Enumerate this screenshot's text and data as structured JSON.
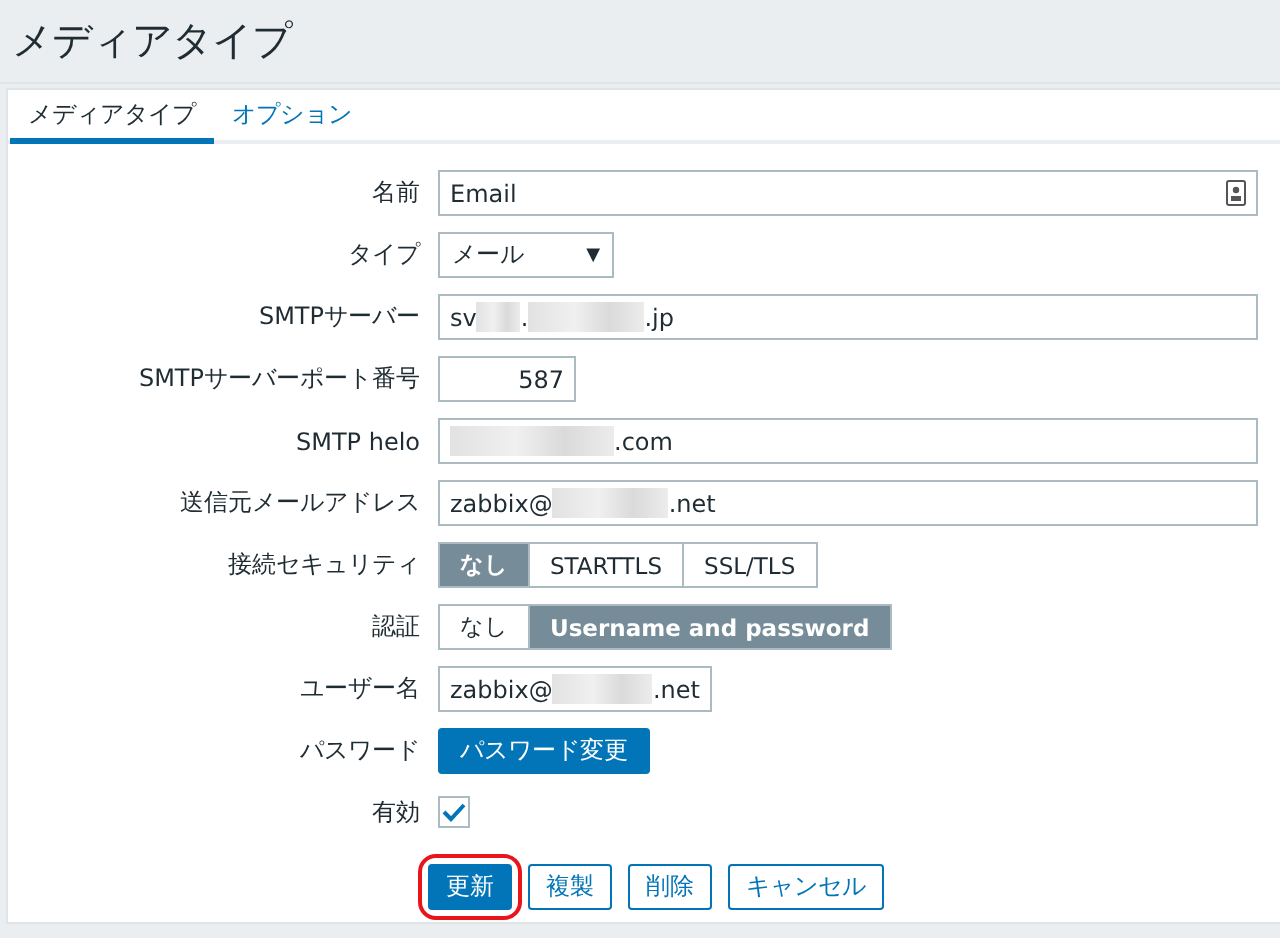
{
  "page": {
    "title": "メディアタイプ"
  },
  "tabs": [
    {
      "label": "メディアタイプ",
      "selected": true
    },
    {
      "label": "オプション",
      "selected": false
    }
  ],
  "form": [
    {
      "kind": "text",
      "label": "名前",
      "icon": true,
      "segments": [
        {
          "kind": "text",
          "text": "Email"
        }
      ]
    },
    {
      "kind": "select",
      "label": "タイプ",
      "value": "メール",
      "arrow": "▼"
    },
    {
      "kind": "text",
      "label": "SMTPサーバー",
      "segments": [
        {
          "kind": "text",
          "text": "sv"
        },
        {
          "kind": "mask-s"
        },
        {
          "kind": "text",
          "text": "."
        },
        {
          "kind": "mask-m"
        },
        {
          "kind": "text",
          "text": ".jp"
        }
      ]
    },
    {
      "kind": "number",
      "label": "SMTPサーバーポート番号",
      "value": "587"
    },
    {
      "kind": "text",
      "label": "SMTP helo",
      "segments": [
        {
          "kind": "mask-l"
        },
        {
          "kind": "text",
          "text": ".com"
        }
      ]
    },
    {
      "kind": "text",
      "label": "送信元メールアドレス",
      "segments": [
        {
          "kind": "text",
          "text": "zabbix@"
        },
        {
          "kind": "mask-m"
        },
        {
          "kind": "text",
          "text": ".net"
        }
      ]
    },
    {
      "kind": "radio",
      "label": "接続セキュリティ",
      "options": [
        {
          "label": "なし",
          "selected": true
        },
        {
          "label": "STARTTLS",
          "selected": false
        },
        {
          "label": "SSL/TLS",
          "selected": false
        }
      ]
    },
    {
      "kind": "radio",
      "label": "認証",
      "options": [
        {
          "label": "なし",
          "selected": false
        },
        {
          "label": "Username and password",
          "selected": true
        }
      ]
    },
    {
      "kind": "short-text",
      "label": "ユーザー名",
      "segments": [
        {
          "kind": "text",
          "text": "zabbix@"
        },
        {
          "kind": "mask-m"
        },
        {
          "kind": "text",
          "text": ".net"
        }
      ]
    },
    {
      "kind": "button",
      "label": "パスワード",
      "button": "パスワード変更"
    },
    {
      "kind": "checkbox",
      "label": "有効",
      "checked": true
    }
  ],
  "actions": [
    {
      "label": "更新",
      "primary": true,
      "highlighted": true
    },
    {
      "label": "複製",
      "primary": false,
      "highlighted": false
    },
    {
      "label": "削除",
      "primary": false,
      "highlighted": false
    },
    {
      "label": "キャンセル",
      "primary": false,
      "highlighted": false
    }
  ]
}
